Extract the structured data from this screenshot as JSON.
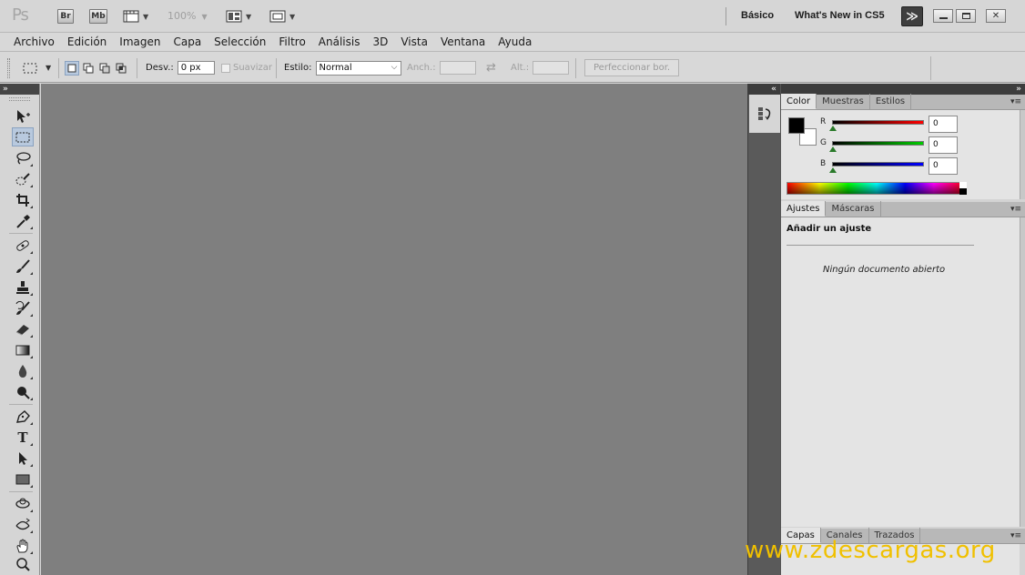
{
  "appbar": {
    "logo": "Ps",
    "bridge_label": "Br",
    "minibridge_label": "Mb",
    "zoom_value": "100%",
    "workspace_basic": "Básico",
    "workspace_new": "What's New in CS5",
    "icons": {
      "view_extras": "ruler-grid-icon",
      "arrange": "arrange-documents-icon",
      "screen_mode": "screen-mode-icon",
      "more_workspaces": "double-chevron-right-icon",
      "minimize": "minimize-icon",
      "restore": "restore-icon",
      "close": "close-icon"
    }
  },
  "menubar": {
    "items": [
      "Archivo",
      "Edición",
      "Imagen",
      "Capa",
      "Selección",
      "Filtro",
      "Análisis",
      "3D",
      "Vista",
      "Ventana",
      "Ayuda"
    ]
  },
  "options": {
    "feather_label": "Desv.:",
    "feather_value": "0 px",
    "antialias_label": "Suavizar",
    "style_label": "Estilo:",
    "style_value": "Normal",
    "width_label": "Anch.:",
    "height_label": "Alt.:",
    "refine_label": "Perfeccionar bor."
  },
  "tools": [
    {
      "name": "move-tool",
      "icon": "move-arrow-icon"
    },
    {
      "name": "rectangular-marquee-tool",
      "icon": "marquee-rect-icon",
      "active": true
    },
    {
      "name": "lasso-tool",
      "icon": "lasso-icon"
    },
    {
      "name": "quick-selection-tool",
      "icon": "quick-selection-icon"
    },
    {
      "name": "crop-tool",
      "icon": "crop-icon"
    },
    {
      "name": "eyedropper-tool",
      "icon": "eyedropper-icon"
    },
    {
      "name": "spot-healing-tool",
      "icon": "bandage-icon"
    },
    {
      "name": "brush-tool",
      "icon": "brush-icon"
    },
    {
      "name": "clone-stamp-tool",
      "icon": "stamp-icon"
    },
    {
      "name": "history-brush-tool",
      "icon": "history-brush-icon"
    },
    {
      "name": "eraser-tool",
      "icon": "eraser-icon"
    },
    {
      "name": "gradient-tool",
      "icon": "gradient-icon"
    },
    {
      "name": "blur-tool",
      "icon": "blur-drop-icon"
    },
    {
      "name": "dodge-tool",
      "icon": "dodge-icon"
    },
    {
      "name": "pen-tool",
      "icon": "pen-icon"
    },
    {
      "name": "type-tool",
      "icon": "type-icon",
      "glyph": "T"
    },
    {
      "name": "path-selection-tool",
      "icon": "path-select-arrow-icon"
    },
    {
      "name": "rectangle-tool",
      "icon": "rectangle-shape-icon"
    },
    {
      "name": "3d-rotate-tool",
      "icon": "3d-rotate-icon"
    },
    {
      "name": "3d-orbit-tool",
      "icon": "3d-orbit-icon"
    },
    {
      "name": "hand-tool",
      "icon": "hand-icon"
    },
    {
      "name": "zoom-tool",
      "icon": "zoom-icon"
    }
  ],
  "color_panel": {
    "tabs": [
      "Color",
      "Muestras",
      "Estilos"
    ],
    "active_tab": "Color",
    "foreground": "#000000",
    "background": "#ffffff",
    "channels": [
      {
        "label": "R",
        "value": "0",
        "gradient": "#ff0000"
      },
      {
        "label": "G",
        "value": "0",
        "gradient": "#00cc00"
      },
      {
        "label": "B",
        "value": "0",
        "gradient": "#0000ff"
      }
    ]
  },
  "adjustments_panel": {
    "tabs": [
      "Ajustes",
      "Máscaras"
    ],
    "active_tab": "Ajustes",
    "title": "Añadir un ajuste",
    "empty_message": "Ningún documento abierto"
  },
  "layers_panel": {
    "tabs": [
      "Capas",
      "Canales",
      "Trazados"
    ],
    "active_tab": "Capas"
  },
  "watermark": "www.zdescargas.org",
  "colors": {
    "canvas": "#7f7f7f",
    "chrome": "#d8d8d8",
    "active_tool": "#b8c9de",
    "watermark": "#f0c000"
  }
}
